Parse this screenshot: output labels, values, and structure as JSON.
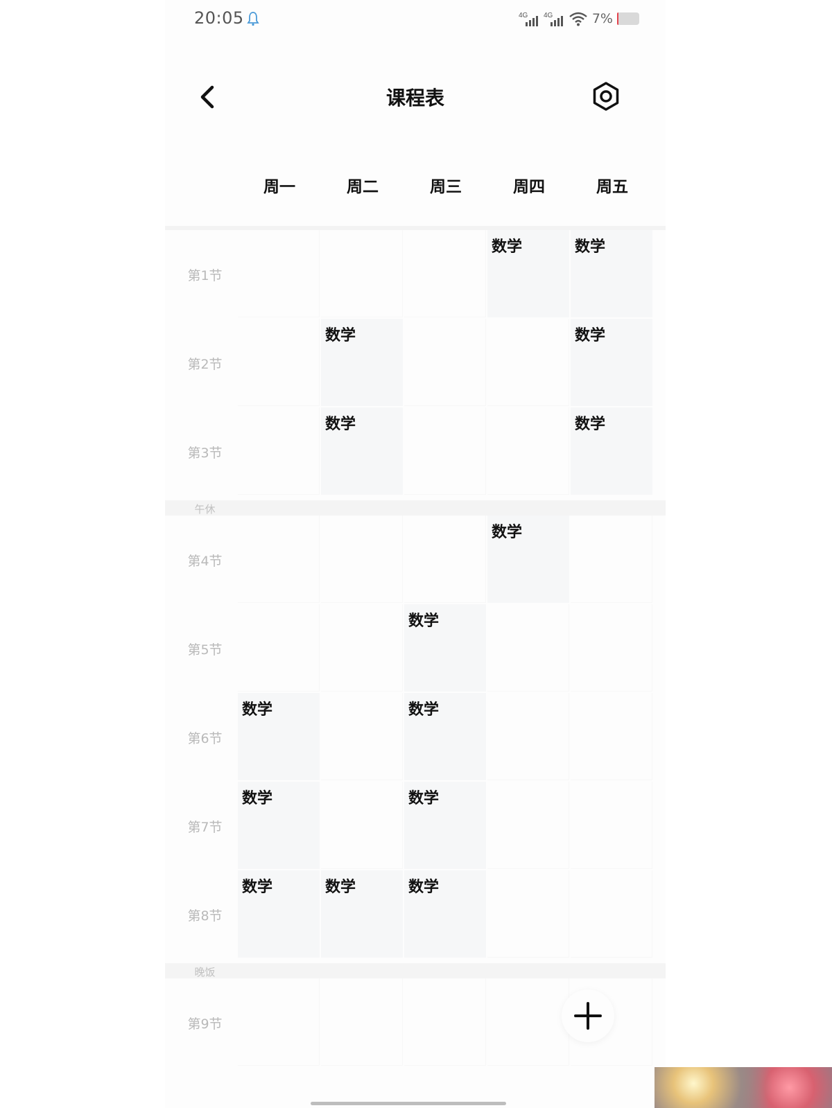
{
  "status_bar": {
    "time": "20:05",
    "network_1": "4G",
    "network_2": "4G",
    "battery_percent": "7%",
    "battery_level": 0.07,
    "battery_color": "#e3414c"
  },
  "header": {
    "title": "课程表",
    "back_icon": "chevron-left-icon",
    "settings_icon": "settings-icon"
  },
  "days": [
    "周一",
    "周二",
    "周三",
    "周四",
    "周五"
  ],
  "periods": [
    {
      "label": "第1节",
      "courses": [
        "",
        "",
        "",
        "数学",
        "数学"
      ]
    },
    {
      "label": "第2节",
      "courses": [
        "",
        "数学",
        "",
        "",
        "数学"
      ]
    },
    {
      "label": "第3节",
      "courses": [
        "",
        "数学",
        "",
        "",
        "数学"
      ]
    },
    {
      "label": "第4节",
      "courses": [
        "",
        "",
        "",
        "数学",
        ""
      ]
    },
    {
      "label": "第5节",
      "courses": [
        "",
        "",
        "数学",
        "",
        ""
      ]
    },
    {
      "label": "第6节",
      "courses": [
        "数学",
        "",
        "数学",
        "",
        ""
      ]
    },
    {
      "label": "第7节",
      "courses": [
        "数学",
        "",
        "数学",
        "",
        ""
      ]
    },
    {
      "label": "第8节",
      "courses": [
        "数学",
        "数学",
        "数学",
        "",
        ""
      ]
    },
    {
      "label": "第9节",
      "courses": [
        "",
        "",
        "",
        "",
        ""
      ]
    }
  ],
  "breaks": {
    "lunch": "午休",
    "dinner": "晚饭"
  },
  "fab_icon": "plus-icon"
}
